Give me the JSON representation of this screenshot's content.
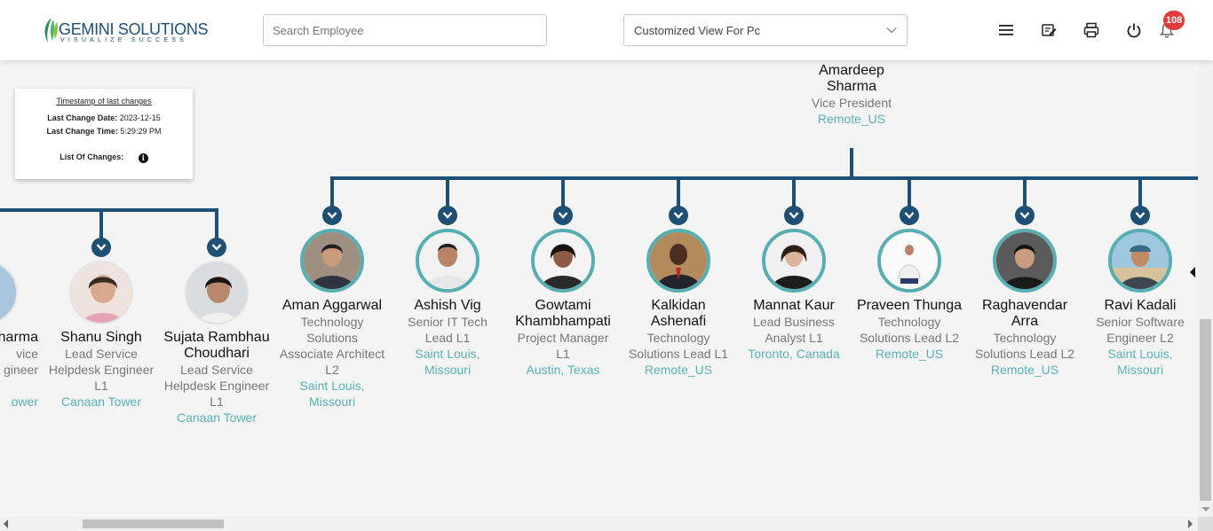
{
  "header": {
    "logo_text": "GEMINI SOLUTIONS",
    "logo_tagline": "VISUALIZE SUCCESS",
    "search_placeholder": "Search Employee",
    "view_selected": "Customized View For Pc",
    "notification_count": "108",
    "icons": [
      "menu-icon",
      "edit-note-icon",
      "print-icon",
      "power-icon",
      "bell-icon"
    ]
  },
  "timestamp": {
    "title": "Timestamp of last changes",
    "date_label": "Last Change Date:",
    "date_value": "2023-12-15",
    "time_label": "Last Change Time:",
    "time_value": "5:29:29 PM",
    "changes_label": "List Of Changes:"
  },
  "colors": {
    "brand": "#1e4f74",
    "accent": "#58b3b8",
    "badge": "#e23b3b"
  },
  "manager": {
    "name_line1": "Amardeep",
    "name_line2": "Sharma",
    "title": "Vice President",
    "location": "Remote_US"
  },
  "left_branch": [
    {
      "name": "harma",
      "title1": "vice",
      "title2": "gineer",
      "location": "ower"
    },
    {
      "name": "Shanu Singh",
      "title1": "Lead Service",
      "title2": "Helpdesk Engineer",
      "title3": "L1",
      "location": "Canaan Tower"
    },
    {
      "name1": "Sujata Rambhau",
      "name2": "Choudhari",
      "title1": "Lead Service",
      "title2": "Helpdesk Engineer",
      "title3": "L1",
      "location": "Canaan Tower"
    }
  ],
  "reports": [
    {
      "name": "Aman Aggarwal",
      "title1": "Technology",
      "title2": "Solutions",
      "title3": "Associate Architect",
      "title4": "L2",
      "loc1": "Saint Louis,",
      "loc2": "Missouri"
    },
    {
      "name": "Ashish Vig",
      "title1": "Senior IT Tech",
      "title2": "Lead L1",
      "loc1": "Saint Louis,",
      "loc2": "Missouri"
    },
    {
      "name1": "Gowtami",
      "name2": "Khambhampati",
      "title1": "Project Manager",
      "title2": "L1",
      "loc1": "Austin, Texas"
    },
    {
      "name1": "Kalkidan",
      "name2": "Ashenafi",
      "title1": "Technology",
      "title2": "Solutions Lead L1",
      "loc1": "Remote_US"
    },
    {
      "name": "Mannat Kaur",
      "title1": "Lead Business",
      "title2": "Analyst L1",
      "loc1": "Toronto, Canada"
    },
    {
      "name": "Praveen Thunga",
      "title1": "Technology",
      "title2": "Solutions Lead L2",
      "loc1": "Remote_US"
    },
    {
      "name1": "Raghavendar",
      "name2": "Arra",
      "title1": "Technology",
      "title2": "Solutions Lead L2",
      "loc1": "Remote_US"
    },
    {
      "name": "Ravi Kadali",
      "title1": "Senior Software",
      "title2": "Engineer L2",
      "loc1": "Saint Louis,",
      "loc2": "Missouri"
    }
  ]
}
